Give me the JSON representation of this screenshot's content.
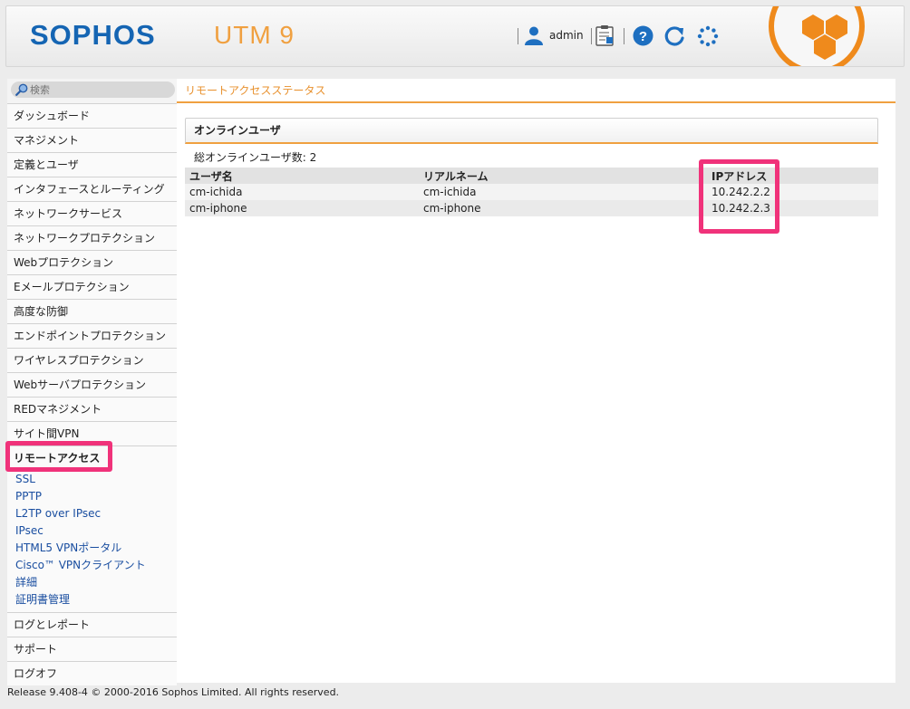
{
  "header": {
    "logo": "SOPHOS",
    "product": "UTM 9",
    "user_label": "admin",
    "icons": [
      "user-icon",
      "clipboard-icon",
      "help-icon",
      "reload-icon",
      "spinner-icon",
      "brand-hexagon-icon"
    ]
  },
  "sidebar": {
    "search_placeholder": "検索",
    "items": [
      {
        "label": "ダッシュボード"
      },
      {
        "label": "マネジメント"
      },
      {
        "label": "定義とユーザ"
      },
      {
        "label": "インタフェースとルーティング"
      },
      {
        "label": "ネットワークサービス"
      },
      {
        "label": "ネットワークプロテクション"
      },
      {
        "label": "Webプロテクション"
      },
      {
        "label": "Eメールプロテクション"
      },
      {
        "label": "高度な防御"
      },
      {
        "label": "エンドポイントプロテクション"
      },
      {
        "label": "ワイヤレスプロテクション"
      },
      {
        "label": "Webサーバプロテクション"
      },
      {
        "label": "REDマネジメント"
      },
      {
        "label": "サイト間VPN"
      },
      {
        "label": "リモートアクセス"
      },
      {
        "label": "ログとレポート"
      },
      {
        "label": "サポート"
      },
      {
        "label": "ログオフ"
      }
    ],
    "sub_items": [
      {
        "label": "SSL"
      },
      {
        "label": "PPTP"
      },
      {
        "label": "L2TP over IPsec"
      },
      {
        "label": "IPsec"
      },
      {
        "label": "HTML5 VPNポータル"
      },
      {
        "label": "Cisco™ VPNクライアント"
      },
      {
        "label": "詳細"
      },
      {
        "label": "証明書管理"
      }
    ],
    "highlight_color": "#f0327a"
  },
  "main": {
    "title": "リモートアクセスステータス",
    "panel": {
      "title": "オンラインユーザ",
      "count_text": "総オンラインユーザ数: 2",
      "columns": [
        "ユーザ名",
        "リアルネーム",
        "IPアドレス"
      ],
      "rows": [
        [
          "cm-ichida",
          "cm-ichida",
          "10.242.2.2"
        ],
        [
          "cm-iphone",
          "cm-iphone",
          "10.242.2.3"
        ]
      ]
    }
  },
  "footer": {
    "text": "Release 9.408-4  © 2000-2016 Sophos Limited. All rights reserved."
  },
  "colors": {
    "accent": "#f0a040",
    "brand_blue": "#1565b3",
    "highlight": "#f0327a"
  }
}
